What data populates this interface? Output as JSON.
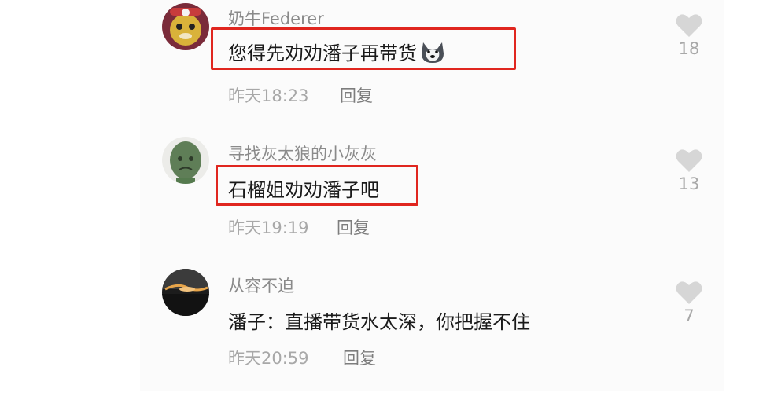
{
  "comments": [
    {
      "username": "奶牛Federer",
      "text": "您得先劝劝潘子再带货",
      "time": "昨天18:23",
      "reply_label": "回复",
      "likes": "18",
      "emoji_icon": "husky-dog-emoji",
      "highlighted": true
    },
    {
      "username": "寻找灰太狼的小灰灰",
      "text": "石榴姐劝劝潘子吧",
      "time": "昨天19:19",
      "reply_label": "回复",
      "likes": "13",
      "highlighted": true
    },
    {
      "username": "从容不迫",
      "text": "潘子：直播带货水太深，你把握不住",
      "time": "昨天20:59",
      "reply_label": "回复",
      "likes": "7",
      "highlighted": false
    }
  ],
  "colors": {
    "highlight_border": "#e0261f",
    "like_icon": "#d6d6d6",
    "username": "#8a8a8a",
    "meta": "#a8a8a8"
  }
}
